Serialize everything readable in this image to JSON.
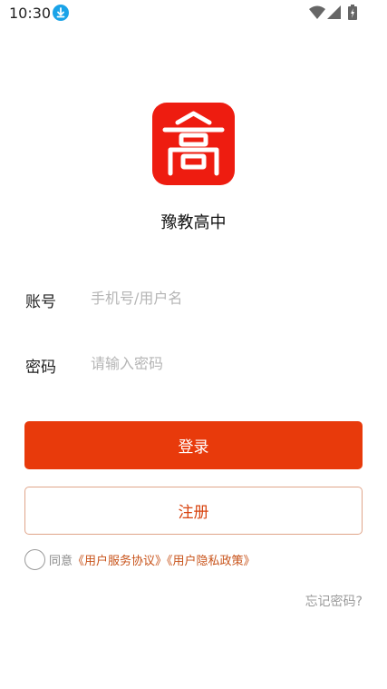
{
  "status_bar": {
    "time": "10:30"
  },
  "app": {
    "name": "豫教高中",
    "logo_glyph": "高",
    "brand_color": "#ee1c10"
  },
  "form": {
    "account_label": "账号",
    "account_placeholder": "手机号/用户名",
    "account_value": "",
    "password_label": "密码",
    "password_placeholder": "请输入密码",
    "password_value": ""
  },
  "actions": {
    "login_label": "登录",
    "register_label": "注册",
    "accent_color": "#e83a0b"
  },
  "agreement": {
    "checked": false,
    "prefix": "同意",
    "service_link": "《用户服务协议》",
    "privacy_link": "《用户隐私政策》"
  },
  "forgot_password": "忘记密码?"
}
